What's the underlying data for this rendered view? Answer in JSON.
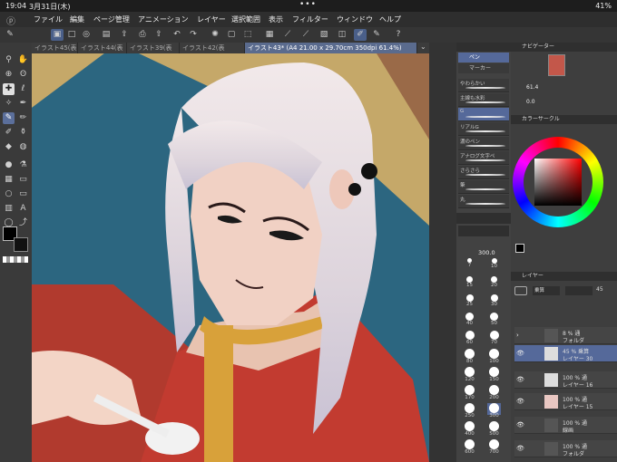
{
  "status": {
    "time": "19:04",
    "date": "3月31日(木)",
    "battery": "41%"
  },
  "menu": [
    "ファイル",
    "編集",
    "ページ管理",
    "アニメーション",
    "レイヤー",
    "選択範囲",
    "表示",
    "フィルター",
    "ウィンドウ",
    "ヘルプ"
  ],
  "tabs": [
    {
      "label": "イラスト45(表"
    },
    {
      "label": "イラスト44(表"
    },
    {
      "label": "イラスト39(表"
    },
    {
      "label": "イラスト42(表"
    },
    {
      "label": "イラスト43* (A4 21.00 x 29.70cm 350dpi 61.4%)"
    }
  ],
  "subtool": {
    "tabs": [
      "ペン",
      "マーカー"
    ],
    "brushes": [
      "やわらかい",
      "主線も水彩",
      "G",
      "リアルG",
      "濃のペン",
      "アナログ文字ペ",
      "さらさら",
      "筆",
      "丸"
    ],
    "size_value": "300.0",
    "sizes": [
      "7",
      "10",
      "15",
      "20",
      "25",
      "30",
      "40",
      "50",
      "60",
      "70",
      "80",
      "100",
      "120",
      "150",
      "170",
      "200",
      "250",
      "300",
      "400",
      "500",
      "600",
      "700"
    ]
  },
  "navigator": {
    "title": "ナビゲーター",
    "zoom": "61.4",
    "rotate": "0.0"
  },
  "color": {
    "title": "カラーサークル"
  },
  "layers": {
    "title": "レイヤー",
    "blend": "乗算",
    "opacity": "45",
    "items": [
      {
        "line1": "8 % 通",
        "line2": "フォルダ"
      },
      {
        "line1": "45 % 乗算",
        "line2": "レイヤー 30"
      },
      {
        "line1": "100 % 通",
        "line2": "レイヤー 16"
      },
      {
        "line1": "100 % 通",
        "line2": "レイヤー 15"
      },
      {
        "line1": "100 % 通",
        "line2": "線画"
      },
      {
        "line1": "100 % 通",
        "line2": "フォルダ"
      }
    ]
  }
}
